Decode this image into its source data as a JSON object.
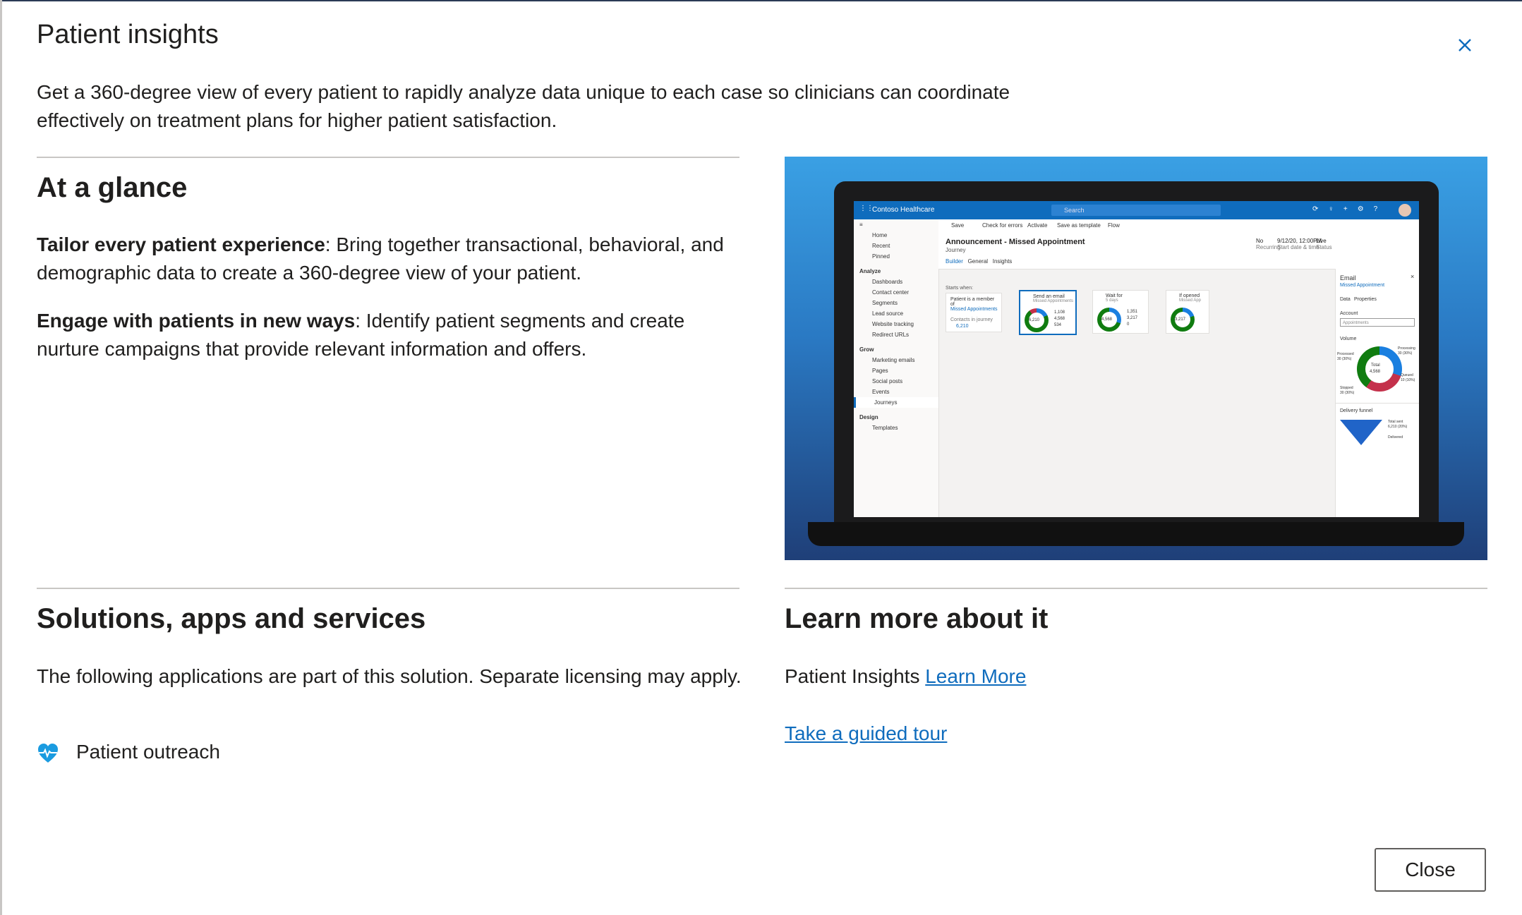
{
  "dialog": {
    "title": "Patient insights",
    "intro": "Get a 360-degree view of every patient to rapidly analyze data unique to each case so clinicians can coordinate effectively on treatment plans for higher patient satisfaction.",
    "close_icon": "close-icon",
    "close_button": "Close"
  },
  "at_a_glance": {
    "heading": "At a glance",
    "items": [
      {
        "bold": "Tailor every patient experience",
        "text": ": Bring together transactional, behavioral, and demographic data to create a 360-degree view of your patient."
      },
      {
        "bold": "Engage with patients in new ways",
        "text": ": Identify patient segments and create nurture campaigns that provide relevant information and offers."
      }
    ]
  },
  "hero_screenshot": {
    "app_name": "Contoso Healthcare",
    "search_placeholder": "Search",
    "commands": [
      "Save",
      "Check for errors",
      "Activate",
      "Save as template",
      "Flow"
    ],
    "title": "Announcement - Missed Appointment",
    "subtitle": "Journey",
    "tabs": [
      "Builder",
      "General",
      "Insights"
    ],
    "meta": [
      {
        "value": "No",
        "label": "Recurring"
      },
      {
        "value": "9/12/20, 12:00PM",
        "label": "Start date & time"
      },
      {
        "value": "Live",
        "label": "Status"
      }
    ],
    "nav": [
      {
        "label": "Home",
        "type": "item"
      },
      {
        "label": "Recent",
        "type": "item"
      },
      {
        "label": "Pinned",
        "type": "item"
      },
      {
        "label": "Analyze",
        "type": "group"
      },
      {
        "label": "Dashboards",
        "type": "item"
      },
      {
        "label": "Contact center",
        "type": "item"
      },
      {
        "label": "Segments",
        "type": "item"
      },
      {
        "label": "Lead source",
        "type": "item"
      },
      {
        "label": "Website tracking",
        "type": "item"
      },
      {
        "label": "Redirect URLs",
        "type": "item"
      },
      {
        "label": "Grow",
        "type": "group"
      },
      {
        "label": "Marketing emails",
        "type": "item"
      },
      {
        "label": "Pages",
        "type": "item"
      },
      {
        "label": "Social posts",
        "type": "item"
      },
      {
        "label": "Events",
        "type": "item"
      },
      {
        "label": "Journeys",
        "type": "selected"
      },
      {
        "label": "Design",
        "type": "group"
      },
      {
        "label": "Templates",
        "type": "item"
      }
    ],
    "canvas": {
      "starts_when": "Starts when:",
      "start_card": {
        "line1": "Patient is a member of",
        "line2": "Missed Appointments",
        "line3": "Contacts in journey",
        "count": "6,210"
      },
      "cards": [
        {
          "title": "Send an email",
          "sub": "Missed Appointments",
          "center": "6,210",
          "stats": [
            "1,108",
            "4,568",
            "534"
          ]
        },
        {
          "title": "Wait for",
          "sub": "5 days",
          "center": "4,568",
          "stats": [
            "1,351",
            "3,217",
            "0"
          ]
        },
        {
          "title": "If opened",
          "sub": "Missed App",
          "center": "3,217",
          "stats": []
        }
      ]
    },
    "panel": {
      "title": "Email",
      "link": "Missed Appointment",
      "tabs": [
        "Data",
        "Properties"
      ],
      "account_label": "Account",
      "account_placeholder": "Appointments",
      "volume_label": "Volume",
      "donut_center": "Total",
      "donut_total": "4,568",
      "labels": [
        {
          "name": "Processed",
          "value": "30 (30%)"
        },
        {
          "name": "Processing",
          "value": "30 (30%)"
        },
        {
          "name": "Queued",
          "value": "10 (10%)"
        },
        {
          "name": "Stopped",
          "value": "30 (30%)"
        }
      ],
      "funnel_label": "Delivery funnel",
      "funnel_total_label": "Total sent",
      "funnel_total_value": "6,210 (20%)",
      "funnel_next": "Delivered"
    }
  },
  "solutions": {
    "heading": "Solutions, apps and services",
    "text": "The following applications are part of this solution. Separate licensing may apply.",
    "apps": [
      {
        "name": "Patient outreach",
        "icon": "heart-pulse-icon"
      }
    ]
  },
  "learn_more": {
    "heading": "Learn more about it",
    "prefix": "Patient Insights",
    "link": "Learn More",
    "tour_link": "Take a guided tour"
  },
  "colors": {
    "accent": "#0f6cbd",
    "hero_top": "#3aa0e4",
    "hero_bottom": "#1f3f78"
  }
}
